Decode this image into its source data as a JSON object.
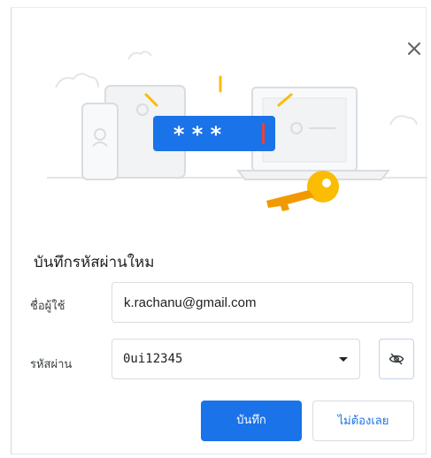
{
  "dialog": {
    "title": "บันทึกรหัสผ่านใหม",
    "close_icon": "close-icon",
    "illustration": {
      "masked_password": "* * *",
      "icons": [
        "phone-icon",
        "tablet-icon",
        "laptop-icon",
        "key-icon",
        "cloud-icon"
      ]
    },
    "username": {
      "label": "ชื่อผู้ใช้",
      "value": "k.rachanu@gmail.com"
    },
    "password": {
      "label": "รหัสผ่าน",
      "value": "0ui12345",
      "dropdown_icon": "chevron-down-icon",
      "toggle_icon": "eye-off-icon"
    },
    "buttons": {
      "save_label": "บันทึก",
      "never_label": "ไม่ต้องเลย"
    }
  },
  "colors": {
    "accent": "#1a73e8",
    "key": "#fbbc04",
    "line_art": "#dadce0"
  }
}
